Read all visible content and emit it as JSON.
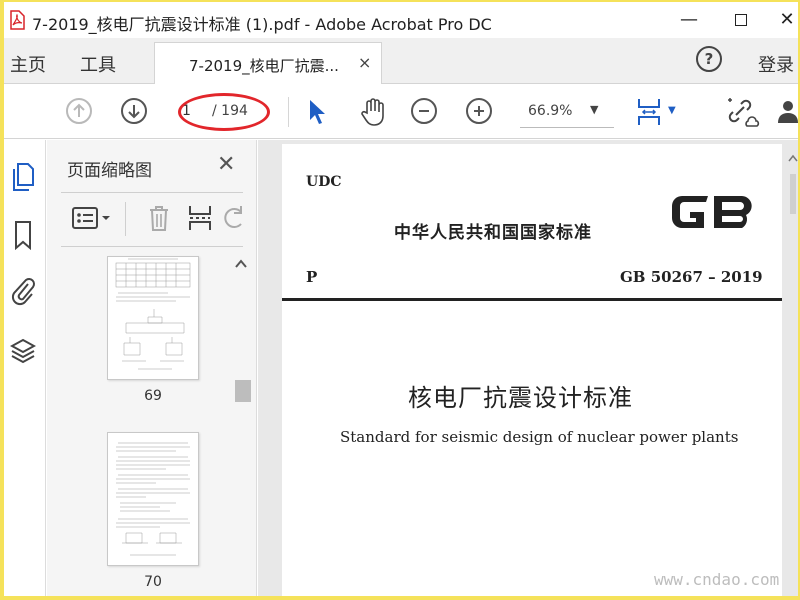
{
  "window": {
    "title": "7-2019_核电厂抗震设计标准 (1).pdf - Adobe Acrobat Pro DC",
    "app_icon": "acrobat-pdf-icon",
    "controls": {
      "minimize": "—",
      "close": "✕"
    }
  },
  "menu": {
    "home": "主页",
    "tools": "工具",
    "tab_label": "7-2019_核电厂抗震...",
    "tab_close": "×",
    "help": "?",
    "login": "登录"
  },
  "toolbar": {
    "page_current": "1",
    "page_total": "/ 194",
    "zoom": "66.9%",
    "dropdown_arrow": "▼",
    "icons": [
      "arrow-up-circle-icon",
      "arrow-down-circle-icon",
      "pointer-icon",
      "hand-icon",
      "zoom-out-icon",
      "zoom-in-icon",
      "fit-page-icon",
      "link-icon",
      "user-icon"
    ],
    "accent_color": "#1f5ec4",
    "annotation_color": "#e2262b"
  },
  "sidebar": {
    "panel_title": "页面缩略图",
    "panel_close": "✕",
    "icons": [
      "pages-icon",
      "bookmark-icon",
      "attachment-icon",
      "layers-icon"
    ],
    "thumbnails": [
      {
        "page": "69"
      },
      {
        "page": "70"
      }
    ]
  },
  "document": {
    "udc": "UDC",
    "standard_cn": "中华人民共和国国家标准",
    "logo": "GB",
    "p": "P",
    "gb_number": "GB 50267 – 2019",
    "title_cn": "核电厂抗震设计标准",
    "title_en": "Standard for seismic design of nuclear power plants"
  },
  "watermark": "www.cndao.com"
}
